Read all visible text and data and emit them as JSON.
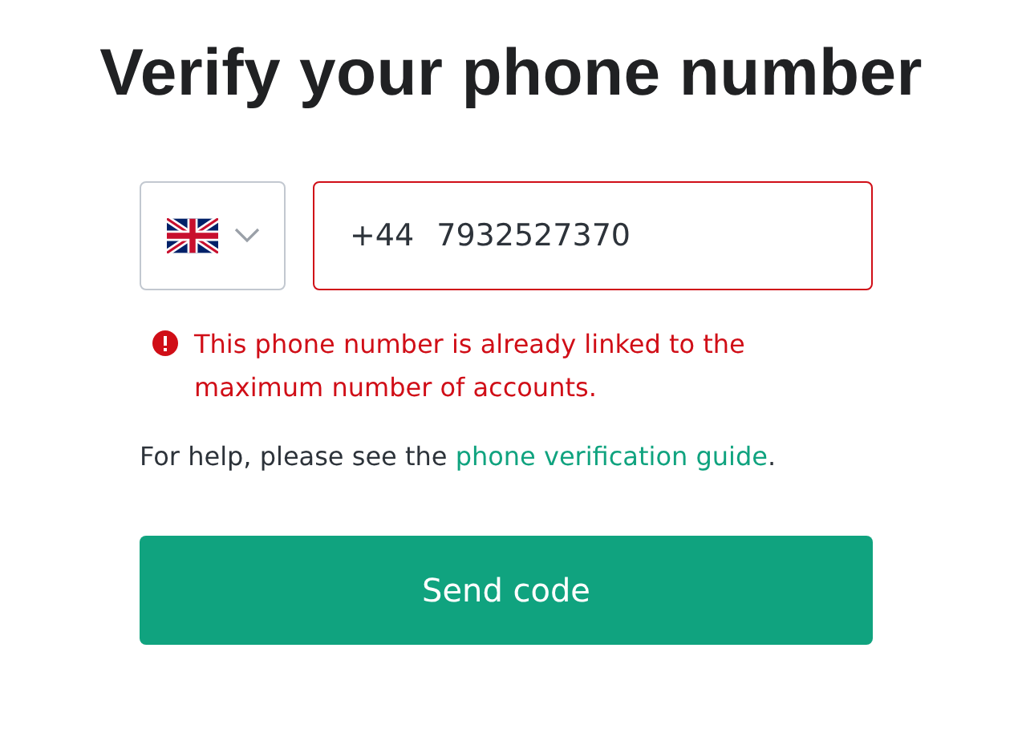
{
  "title": "Verify your phone number",
  "phone": {
    "country_code": "+44",
    "value": "7932527370",
    "invalid": true
  },
  "error": "This phone number is already linked to the maximum number of accounts.",
  "help": {
    "text": "For help, please see the ",
    "link": "phone verification guide",
    "after": "."
  },
  "button": "Send code"
}
